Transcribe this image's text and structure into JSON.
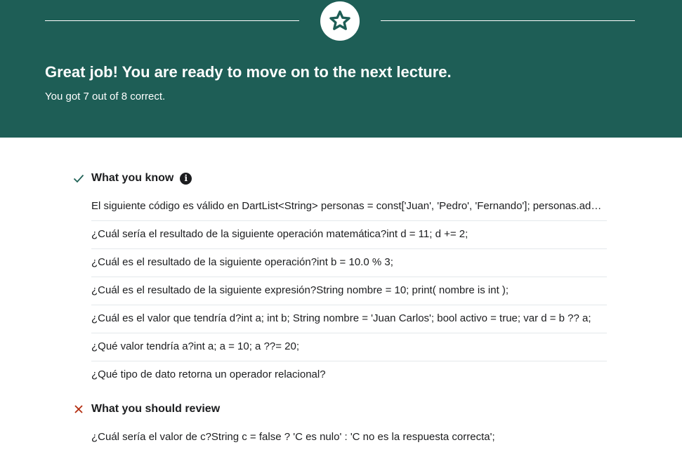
{
  "header": {
    "headline": "Great job! You are ready to move on to the next lecture.",
    "score_text": "You got 7 out of 8 correct.",
    "badge_icon": "star-icon",
    "background_color": "#1e5e56"
  },
  "know": {
    "title": "What you know",
    "status_icon": "check-icon",
    "info_icon": "info-icon",
    "items": [
      "El siguiente código es válido en DartList<String> personas = const['Juan', 'Pedro', 'Fernando']; personas.add('Melissa');",
      "¿Cuál sería el resultado de la siguiente operación matemática?int d = 11; d += 2;",
      "¿Cuál es el resultado de la siguiente operación?int b = 10.0 % 3;",
      "¿Cuál es el resultado de la siguiente expresión?String nombre = 10; print( nombre is int );",
      "¿Cuál es el valor que tendría d?int a; int b; String nombre = 'Juan Carlos'; bool activo = true; var d = b ?? a;",
      "¿Qué valor tendría a?int a; a = 10; a ??= 20;",
      "¿Qué tipo de dato retorna un operador relacional?"
    ]
  },
  "review": {
    "title": "What you should review",
    "status_icon": "x-icon",
    "items": [
      "¿Cuál sería el valor de c?String c = false ? 'C es nulo' : 'C no es la respuesta correcta';"
    ]
  }
}
